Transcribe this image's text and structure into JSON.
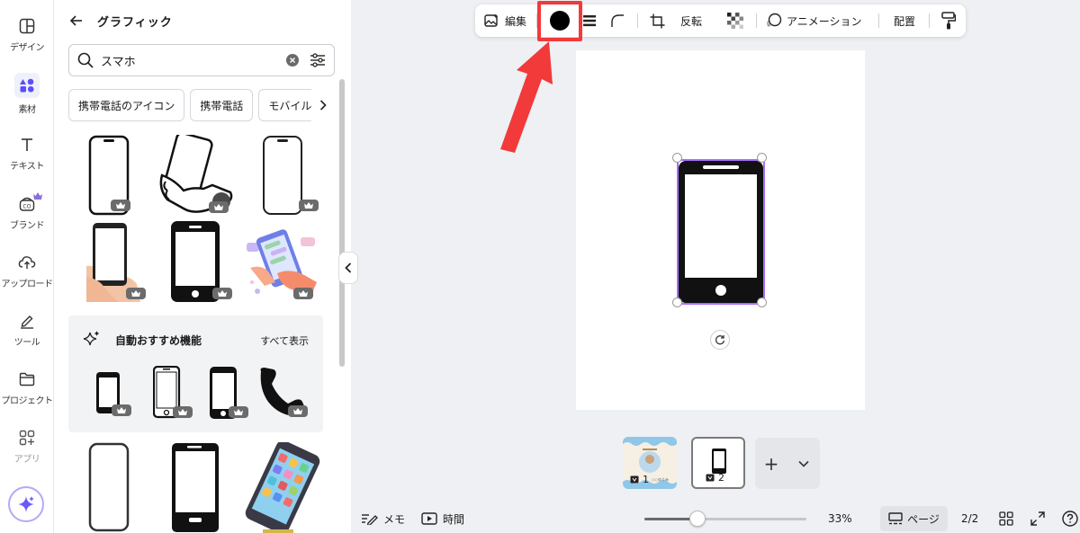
{
  "rail": {
    "items": [
      {
        "label": "デザイン",
        "icon": "layout-icon"
      },
      {
        "label": "素材",
        "icon": "elements-icon"
      },
      {
        "label": "テキスト",
        "icon": "text-icon"
      },
      {
        "label": "ブランド",
        "icon": "brand-icon"
      },
      {
        "label": "アップロード",
        "icon": "upload-cloud-icon"
      },
      {
        "label": "ツール",
        "icon": "pen-tool-icon"
      },
      {
        "label": "プロジェクト",
        "icon": "folder-icon"
      },
      {
        "label": "アプリ",
        "icon": "apps-icon"
      }
    ]
  },
  "panel": {
    "title": "グラフィック",
    "search": {
      "value": "スマホ"
    },
    "chips": [
      "携帯電話のアイコン",
      "携帯電話",
      "モバイル"
    ],
    "recommend": {
      "title": "自動おすすめ機能",
      "see_all": "すべて表示"
    }
  },
  "toolbar": {
    "edit_label": "編集",
    "flip_label": "反転",
    "animate_label": "アニメーション",
    "position_label": "配置",
    "color_value": "#000000"
  },
  "pages": [
    {
      "number": "1",
      "caption": "○○ゆうみ"
    },
    {
      "number": "2"
    }
  ],
  "bottom": {
    "notes_label": "メモ",
    "timer_label": "時間",
    "zoom_text": "33%",
    "zoom_value": 33,
    "pages_label": "ページ",
    "page_count": "2/2"
  },
  "colors": {
    "accent": "#7d2ae8",
    "highlight": "#f23a3a",
    "selection": "#8b3dff"
  }
}
